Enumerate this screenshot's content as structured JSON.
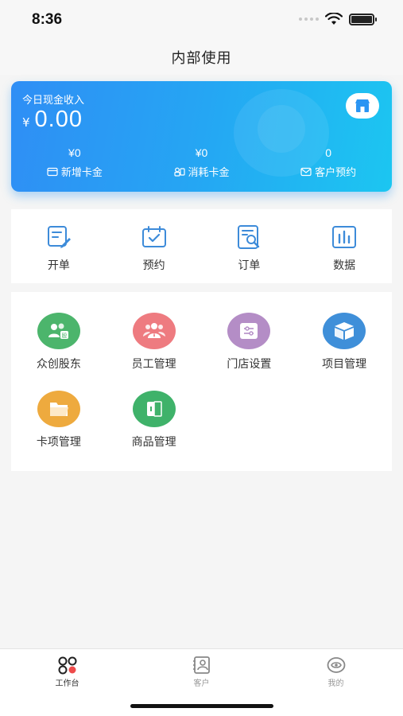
{
  "status_bar": {
    "time": "8:36"
  },
  "nav": {
    "title": "内部使用"
  },
  "income_card": {
    "label": "今日现金收入",
    "currency": "¥",
    "amount": "0.00",
    "stats": [
      {
        "value": "¥0",
        "label": "新增卡金",
        "icon": "card-icon"
      },
      {
        "value": "¥0",
        "label": "消耗卡金",
        "icon": "consume-icon"
      },
      {
        "value": "0",
        "label": "客户预约",
        "icon": "mail-icon"
      }
    ]
  },
  "quick_actions": [
    {
      "label": "开单",
      "icon": "edit-doc-icon"
    },
    {
      "label": "预约",
      "icon": "calendar-check-icon"
    },
    {
      "label": "订单",
      "icon": "order-search-icon"
    },
    {
      "label": "数据",
      "icon": "bar-chart-icon"
    }
  ],
  "management": [
    {
      "label": "众创股东",
      "icon": "shareholder-icon",
      "color": "#4cb56c"
    },
    {
      "label": "员工管理",
      "icon": "staff-icon",
      "color": "#ee7b80"
    },
    {
      "label": "门店设置",
      "icon": "store-settings-icon",
      "color": "#b48dc6"
    },
    {
      "label": "项目管理",
      "icon": "project-box-icon",
      "color": "#3f8fd9"
    },
    {
      "label": "卡项管理",
      "icon": "folder-icon",
      "color": "#eeaa3e"
    },
    {
      "label": "商品管理",
      "icon": "product-icon",
      "color": "#3fb26a"
    }
  ],
  "tabs": [
    {
      "label": "工作台",
      "active": true
    },
    {
      "label": "客户",
      "active": false
    },
    {
      "label": "我的",
      "active": false
    }
  ],
  "colors": {
    "primary": "#2b95f3",
    "card_gradient_end": "#1cc6f1",
    "tab_active_accent": "#ee4b4b"
  }
}
